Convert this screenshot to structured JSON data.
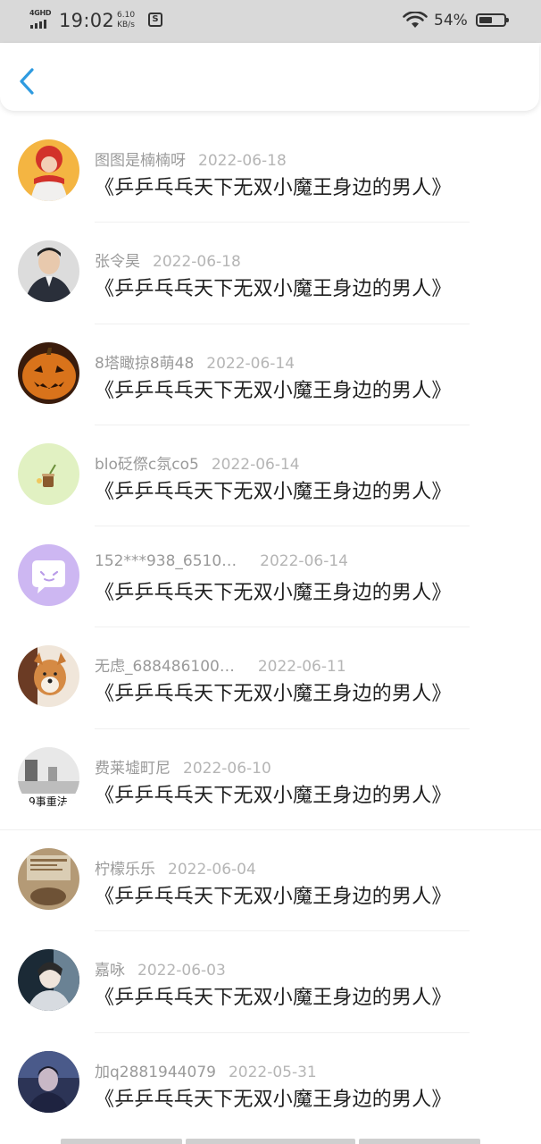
{
  "status_bar": {
    "network": "4GHD",
    "time": "19:02",
    "speed_value": "6.10",
    "speed_unit": "KB/s",
    "battery": "54%",
    "battery_level": 0.54
  },
  "header": {
    "back_icon": "chevron-left-icon",
    "accent": "#2f9be0"
  },
  "title_text": "《乒乒乓乓天下无双小魔王身边的男人》",
  "items": [
    {
      "user": "图图是楠楠呀",
      "date": "2022-06-18",
      "title": "《乒乒乓乓天下无双小魔王身边的男人》"
    },
    {
      "user": "张令昊",
      "date": "2022-06-18",
      "title": "《乒乒乓乓天下无双小魔王身边的男人》"
    },
    {
      "user": "8塔瞰掠8萌48",
      "date": "2022-06-14",
      "title": "《乒乒乓乓天下无双小魔王身边的男人》"
    },
    {
      "user": "blo砭傺c氛co5",
      "date": "2022-06-14",
      "title": "《乒乒乓乓天下无双小魔王身边的男人》"
    },
    {
      "user": "152***938_6510…",
      "date": "2022-06-14",
      "title": "《乒乒乓乓天下无双小魔王身边的男人》"
    },
    {
      "user": "无虑_688486100…",
      "date": "2022-06-11",
      "title": "《乒乒乓乓天下无双小魔王身边的男人》"
    },
    {
      "user": "费莱墟町尼",
      "date": "2022-06-10",
      "title": "《乒乒乓乓天下无双小魔王身边的男人》"
    },
    {
      "user": "柠檬乐乐",
      "date": "2022-06-04",
      "title": "《乒乒乓乓天下无双小魔王身边的男人》"
    },
    {
      "user": "嘉咏",
      "date": "2022-06-03",
      "title": "《乒乒乓乓天下无双小魔王身边的男人》"
    },
    {
      "user": "加q2881944079",
      "date": "2022-05-31",
      "title": "《乒乒乓乓天下无双小魔王身边的男人》"
    }
  ],
  "avatar_text_7": "9事重法"
}
